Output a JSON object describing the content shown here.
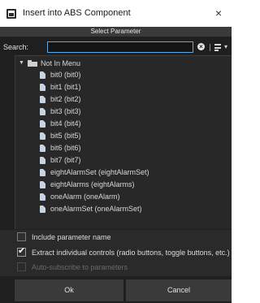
{
  "window": {
    "title": "Insert into ABS Component",
    "close_glyph": "×"
  },
  "header": {
    "title": "Select Parameter"
  },
  "search": {
    "label": "Search:",
    "value": ""
  },
  "icons": {
    "app": "app-window-icon",
    "clear": "clear-circle-icon",
    "sort": "sort-lines-icon",
    "filter": "filter-icon",
    "caret": "caret-down-icon",
    "folder": "folder-icon",
    "file": "file-icon"
  },
  "tree": {
    "root": {
      "label": "Not In Menu",
      "expanded": true
    },
    "items": [
      {
        "label": "bit0 (bit0)"
      },
      {
        "label": "bit1 (bit1)"
      },
      {
        "label": "bit2 (bit2)"
      },
      {
        "label": "bit3 (bit3)"
      },
      {
        "label": "bit4 (bit4)"
      },
      {
        "label": "bit5 (bit5)"
      },
      {
        "label": "bit6 (bit6)"
      },
      {
        "label": "bit7 (bit7)"
      },
      {
        "label": "eightAlarmSet (eightAlarmSet)"
      },
      {
        "label": "eightAlarms (eightAlarms)"
      },
      {
        "label": "oneAlarm (oneAlarm)"
      },
      {
        "label": "oneAlarmSet (oneAlarmSet)"
      }
    ]
  },
  "options": [
    {
      "label": "Include parameter name",
      "checked": false,
      "enabled": true
    },
    {
      "label": "Extract individual controls (radio buttons, toggle buttons, etc.)",
      "checked": true,
      "enabled": true
    },
    {
      "label": "Auto-subscribe to parameters",
      "checked": false,
      "enabled": false
    }
  ],
  "buttons": {
    "ok": "Ok",
    "cancel": "Cancel"
  },
  "colors": {
    "background": "#1f1f1f",
    "panel": "#282828",
    "header": "#3a3a3a",
    "accent": "#5aa9e6",
    "text": "#d8d8d8"
  }
}
